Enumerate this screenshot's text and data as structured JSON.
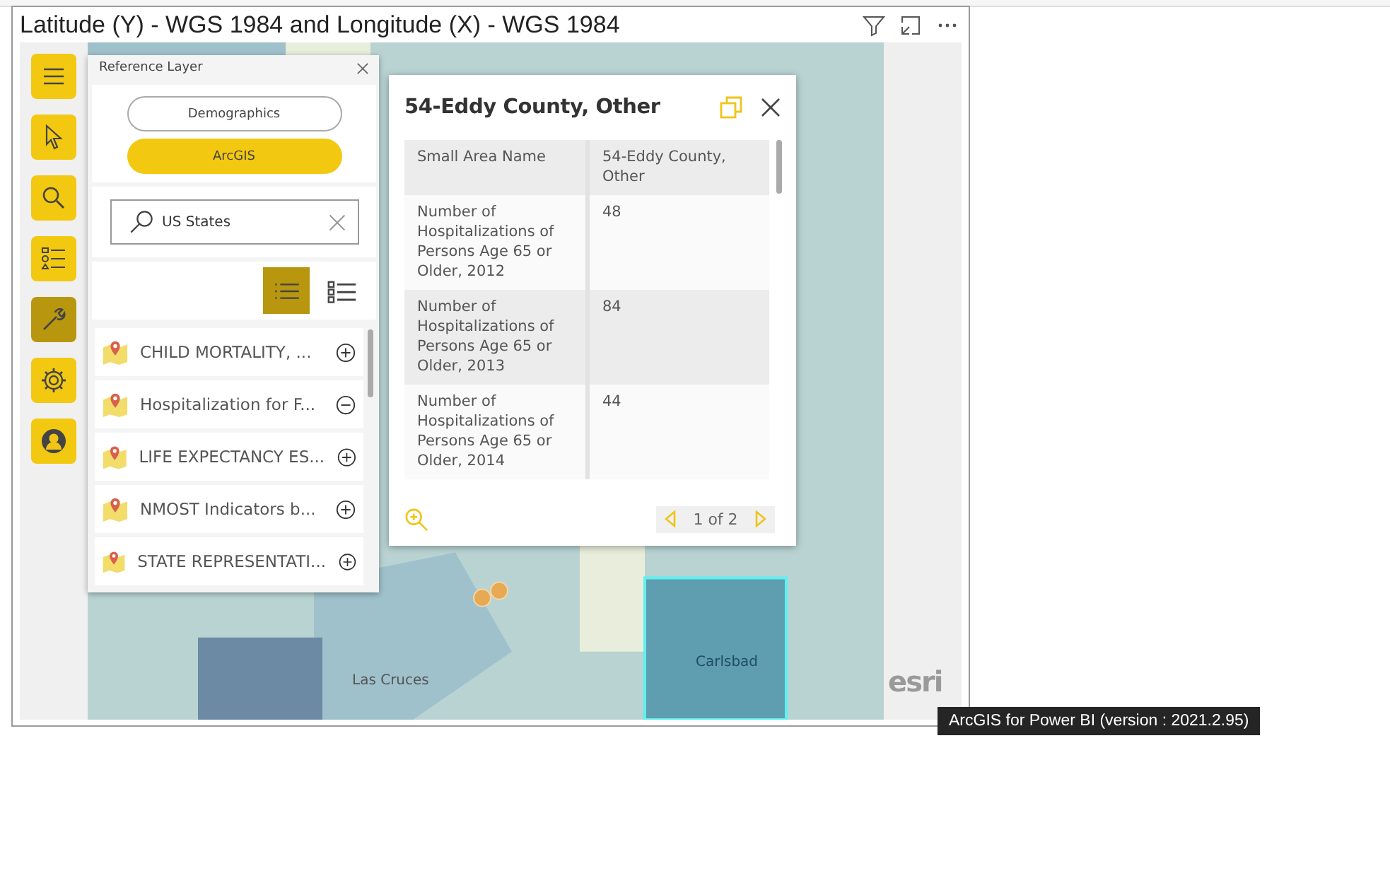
{
  "visual": {
    "title": "Latitude (Y) - WGS 1984 and Longitude (X) - WGS 1984"
  },
  "toolbar": [
    {
      "kind": "menu",
      "selected": false
    },
    {
      "kind": "pointer",
      "selected": false
    },
    {
      "kind": "search",
      "selected": false
    },
    {
      "kind": "legend",
      "selected": false
    },
    {
      "kind": "wrench",
      "selected": true
    },
    {
      "kind": "gear",
      "selected": false
    },
    {
      "kind": "user",
      "selected": false
    }
  ],
  "reference_panel": {
    "title": "Reference Layer",
    "sources": [
      {
        "label": "Demographics",
        "selected": false
      },
      {
        "label": "ArcGIS",
        "selected": true
      }
    ],
    "search": {
      "value": "US States"
    },
    "views": [
      {
        "kind": "list",
        "selected": true
      },
      {
        "kind": "detail",
        "selected": false
      }
    ],
    "layers": [
      {
        "name": "CHILD MORTALITY, ...",
        "added": false
      },
      {
        "name": "Hospitalization for F...",
        "added": true
      },
      {
        "name": "LIFE EXPECTANCY ES...",
        "added": false
      },
      {
        "name": "NMOST Indicators b...",
        "added": false
      },
      {
        "name": "STATE REPRESENTATI...",
        "added": false
      }
    ]
  },
  "popup": {
    "title": "54-Eddy County, Other",
    "rows": [
      {
        "label": "Small Area Name",
        "value": "54-Eddy County, Other"
      },
      {
        "label": "Number of Hospitalizations of Persons Age 65 or Older, 2012",
        "value": "48"
      },
      {
        "label": "Number of Hospitalizations of Persons Age 65 or Older, 2013",
        "value": "84"
      },
      {
        "label": "Number of Hospitalizations of Persons Age 65 or Older, 2014",
        "value": "44"
      }
    ],
    "pager": "1 of 2"
  },
  "map": {
    "labels": [
      {
        "text": "Las Cruces",
        "kind": "city"
      },
      {
        "text": "Carlsbad",
        "kind": "selected-city"
      }
    ],
    "logo": "esri"
  },
  "tooltip": "ArcGIS for Power BI (version : 2021.2.95)"
}
